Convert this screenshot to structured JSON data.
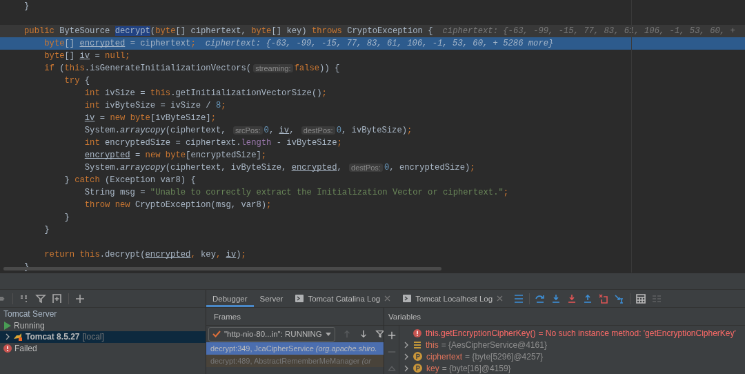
{
  "editor": {
    "lines": [
      {
        "kind": "code",
        "caret": false,
        "execution_point": false,
        "tokens": [
          {
            "kind": "plain",
            "text": "}"
          }
        ]
      },
      {
        "kind": "blank",
        "caret": false,
        "execution_point": false
      },
      {
        "kind": "code",
        "caret": true,
        "execution_point": false,
        "tokens": [
          {
            "kind": "kw",
            "text": "public "
          },
          {
            "kind": "plain",
            "text": "ByteSource "
          },
          {
            "kind": "sel",
            "text": "decrypt"
          },
          {
            "kind": "plain",
            "text": "("
          },
          {
            "kind": "kw",
            "text": "byte"
          },
          {
            "kind": "plain",
            "text": "[] ciphertext, "
          },
          {
            "kind": "kw",
            "text": "byte"
          },
          {
            "kind": "plain",
            "text": "[] key) "
          },
          {
            "kind": "kw",
            "text": "throws "
          },
          {
            "kind": "plain",
            "text": "CryptoException {"
          },
          {
            "kind": "value",
            "text": "ciphertext: {-63, -99, -15, 77, 83, 61, 106, -1, 53, 60, +"
          }
        ]
      },
      {
        "kind": "code",
        "caret": false,
        "execution_point": true,
        "tokens": [
          {
            "kind": "kw",
            "text": "    byte"
          },
          {
            "kind": "plain",
            "text": "[] "
          },
          {
            "kind": "var",
            "text": "encrypted"
          },
          {
            "kind": "plain",
            "text": " = ciphertext"
          },
          {
            "kind": "kw",
            "text": ";"
          },
          {
            "kind": "value",
            "text": "ciphertext: {-63, -99, -15, 77, 83, 61, 106, -1, 53, 60, + 5286 more}"
          }
        ]
      },
      {
        "kind": "code",
        "caret": false,
        "execution_point": false,
        "tokens": [
          {
            "kind": "kw",
            "text": "    byte"
          },
          {
            "kind": "plain",
            "text": "[] "
          },
          {
            "kind": "var",
            "text": "iv"
          },
          {
            "kind": "plain",
            "text": " = "
          },
          {
            "kind": "kw",
            "text": "null;"
          }
        ]
      },
      {
        "kind": "code",
        "caret": false,
        "execution_point": false,
        "tokens": [
          {
            "kind": "kw",
            "text": "    if "
          },
          {
            "kind": "plain",
            "text": "("
          },
          {
            "kind": "kw",
            "text": "this"
          },
          {
            "kind": "plain",
            "text": ".isGenerateInitializationVectors("
          },
          {
            "kind": "hint",
            "text": "streaming:"
          },
          {
            "kind": "kw",
            "text": "false"
          },
          {
            "kind": "plain",
            "text": ")) {"
          }
        ]
      },
      {
        "kind": "code",
        "caret": false,
        "execution_point": false,
        "tokens": [
          {
            "kind": "kw",
            "text": "        try "
          },
          {
            "kind": "plain",
            "text": "{"
          }
        ]
      },
      {
        "kind": "code",
        "caret": false,
        "execution_point": false,
        "tokens": [
          {
            "kind": "kw",
            "text": "            int "
          },
          {
            "kind": "plain",
            "text": "ivSize = "
          },
          {
            "kind": "kw",
            "text": "this"
          },
          {
            "kind": "plain",
            "text": ".getInitializationVectorSize()"
          },
          {
            "kind": "kw",
            "text": ";"
          }
        ]
      },
      {
        "kind": "code",
        "caret": false,
        "execution_point": false,
        "tokens": [
          {
            "kind": "kw",
            "text": "            int "
          },
          {
            "kind": "plain",
            "text": "ivByteSize = ivSize / "
          },
          {
            "kind": "num",
            "text": "8"
          },
          {
            "kind": "kw",
            "text": ";"
          }
        ]
      },
      {
        "kind": "code",
        "caret": false,
        "execution_point": false,
        "tokens": [
          {
            "kind": "var",
            "text": "            iv"
          },
          {
            "kind": "plain",
            "text": " = "
          },
          {
            "kind": "kw",
            "text": "new byte"
          },
          {
            "kind": "plain",
            "text": "[ivByteSize]"
          },
          {
            "kind": "kw",
            "text": ";"
          }
        ]
      },
      {
        "kind": "code",
        "caret": false,
        "execution_point": false,
        "tokens": [
          {
            "kind": "plain",
            "text": "            System."
          },
          {
            "kind": "call",
            "text": "arraycopy"
          },
          {
            "kind": "plain",
            "text": "(ciphertext, "
          },
          {
            "kind": "hint",
            "text": "srcPos:"
          },
          {
            "kind": "num",
            "text": "0"
          },
          {
            "kind": "plain",
            "text": ", "
          },
          {
            "kind": "var",
            "text": "iv"
          },
          {
            "kind": "plain",
            "text": ", "
          },
          {
            "kind": "hint",
            "text": "destPos:"
          },
          {
            "kind": "num",
            "text": "0"
          },
          {
            "kind": "plain",
            "text": ", ivByteSize)"
          },
          {
            "kind": "kw",
            "text": ";"
          }
        ]
      },
      {
        "kind": "code",
        "caret": false,
        "execution_point": false,
        "tokens": [
          {
            "kind": "kw",
            "text": "            int "
          },
          {
            "kind": "plain",
            "text": "encryptedSize = ciphertext."
          },
          {
            "kind": "field",
            "text": "length"
          },
          {
            "kind": "plain",
            "text": " - ivByteSize"
          },
          {
            "kind": "kw",
            "text": ";"
          }
        ]
      },
      {
        "kind": "code",
        "caret": false,
        "execution_point": false,
        "tokens": [
          {
            "kind": "var",
            "text": "            encrypted"
          },
          {
            "kind": "plain",
            "text": " = "
          },
          {
            "kind": "kw",
            "text": "new byte"
          },
          {
            "kind": "plain",
            "text": "[encryptedSize]"
          },
          {
            "kind": "kw",
            "text": ";"
          }
        ]
      },
      {
        "kind": "code",
        "caret": false,
        "execution_point": false,
        "tokens": [
          {
            "kind": "plain",
            "text": "            System."
          },
          {
            "kind": "call",
            "text": "arraycopy"
          },
          {
            "kind": "plain",
            "text": "(ciphertext, ivByteSize, "
          },
          {
            "kind": "var",
            "text": "encrypted"
          },
          {
            "kind": "plain",
            "text": ", "
          },
          {
            "kind": "hint",
            "text": "destPos:"
          },
          {
            "kind": "num",
            "text": "0"
          },
          {
            "kind": "plain",
            "text": ", encryptedSize)"
          },
          {
            "kind": "kw",
            "text": ";"
          }
        ]
      },
      {
        "kind": "code",
        "caret": false,
        "execution_point": false,
        "tokens": [
          {
            "kind": "plain",
            "text": "        } "
          },
          {
            "kind": "kw",
            "text": "catch "
          },
          {
            "kind": "plain",
            "text": "(Exception var8) {"
          }
        ]
      },
      {
        "kind": "code",
        "caret": false,
        "execution_point": false,
        "tokens": [
          {
            "kind": "plain",
            "text": "            String msg = "
          },
          {
            "kind": "str",
            "text": "\"Unable to correctly extract the Initialization Vector or ciphertext.\""
          },
          {
            "kind": "kw",
            "text": ";"
          }
        ]
      },
      {
        "kind": "code",
        "caret": false,
        "execution_point": false,
        "tokens": [
          {
            "kind": "kw",
            "text": "            throw new "
          },
          {
            "kind": "plain",
            "text": "CryptoException(msg, var8)"
          },
          {
            "kind": "kw",
            "text": ";"
          }
        ]
      },
      {
        "kind": "code",
        "caret": false,
        "execution_point": false,
        "tokens": [
          {
            "kind": "plain",
            "text": "        }"
          }
        ]
      },
      {
        "kind": "code",
        "caret": false,
        "execution_point": false,
        "tokens": [
          {
            "kind": "plain",
            "text": "    }"
          }
        ]
      },
      {
        "kind": "blank",
        "caret": false,
        "execution_point": false
      },
      {
        "kind": "code",
        "caret": false,
        "execution_point": false,
        "tokens": [
          {
            "kind": "kw",
            "text": "    return this"
          },
          {
            "kind": "plain",
            "text": ".decrypt("
          },
          {
            "kind": "var",
            "text": "encrypted"
          },
          {
            "kind": "kw",
            "text": ", "
          },
          {
            "kind": "plain",
            "text": "key"
          },
          {
            "kind": "kw",
            "text": ", "
          },
          {
            "kind": "var",
            "text": "iv"
          },
          {
            "kind": "plain",
            "text": ")"
          },
          {
            "kind": "kw",
            "text": ";"
          }
        ]
      },
      {
        "kind": "code",
        "caret": false,
        "execution_point": false,
        "tokens": [
          {
            "kind": "plain",
            "text": "}"
          }
        ]
      }
    ]
  },
  "services": {
    "tree": [
      {
        "label": "Tomcat Server",
        "kind": "group",
        "children": [
          {
            "label": "Running",
            "kind": "running",
            "children": [
              {
                "label": "Tomcat 8.5.27",
                "suffix": "[local]",
                "kind": "server",
                "selected": true,
                "expanded": false
              }
            ]
          },
          {
            "label": "Failed",
            "kind": "failed"
          }
        ]
      }
    ]
  },
  "debugger": {
    "tabs": [
      {
        "label": "Debugger",
        "kind": "plain",
        "selected": true,
        "closable": false
      },
      {
        "label": "Server",
        "kind": "plain",
        "selected": false,
        "closable": false
      },
      {
        "label": "Tomcat Catalina Log",
        "kind": "log",
        "selected": false,
        "closable": true
      },
      {
        "label": "Tomcat Localhost Log",
        "kind": "log",
        "selected": false,
        "closable": true
      }
    ],
    "frames": {
      "title": "Frames",
      "thread": "\"http-nio-80...in\": RUNNING",
      "items": [
        {
          "method": "decrypt:349, JcaCipherService",
          "package": "(org.apache.shiro.",
          "selected": true,
          "library": false
        },
        {
          "method": "decrypt:489, AbstractRememberMeManager",
          "package": "(or",
          "selected": false,
          "library": true
        }
      ]
    },
    "variables": {
      "title": "Variables",
      "items": [
        {
          "kind": "error",
          "name": "this.getEncryptionCipherKey()",
          "value": "= No such instance method: 'getEncryptionCipherKey'"
        },
        {
          "kind": "object",
          "name": "this",
          "value": "= {AesCipherService@4161}"
        },
        {
          "kind": "param",
          "name": "ciphertext",
          "value": "= {byte[5296]@4257}"
        },
        {
          "kind": "param",
          "name": "key",
          "value": "= {byte[16]@4159}"
        }
      ]
    }
  }
}
